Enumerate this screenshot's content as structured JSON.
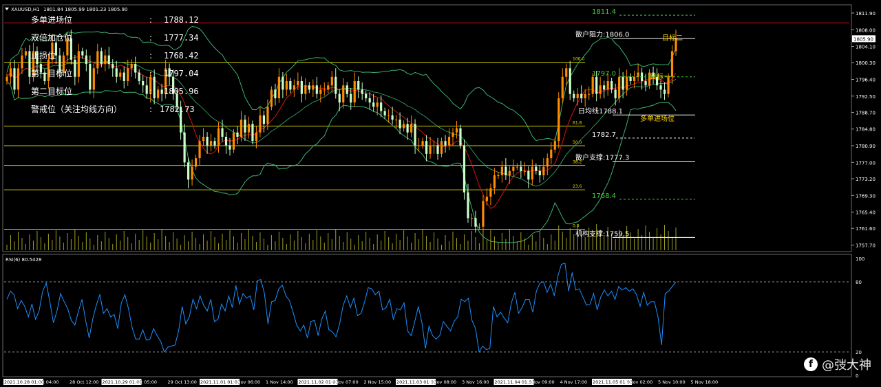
{
  "header": {
    "symbol": "XAUUSD,H1",
    "ohlc": "1801.84 1805.99 1801.23 1805.90"
  },
  "info_panel": [
    {
      "label": "多单进场位",
      "sep": ":",
      "value": "1788.12"
    },
    {
      "label": "双倍加仓位",
      "sep": ":",
      "value": "1777.34"
    },
    {
      "label": "止损位",
      "sep": ":",
      "value": "1768.42"
    },
    {
      "label": "第一目标位",
      "sep": ":",
      "value": "1797.04"
    },
    {
      "label": "第二目标位",
      "sep": ":",
      "value": "1805.96"
    },
    {
      "label": "警戒位（关注均线方向）",
      "sep": ":",
      "value": "1782.73"
    }
  ],
  "price_axis": {
    "ticks": [
      "1811.90",
      "1808.00",
      "1804.10",
      "1800.30",
      "1796.40",
      "1792.50",
      "1788.70",
      "1784.80",
      "1780.90",
      "1777.00",
      "1773.20",
      "1769.30",
      "1765.40",
      "1761.60",
      "1757.70"
    ],
    "current_price": "1805.90",
    "range": [
      1756.5,
      1813.5
    ]
  },
  "rsi": {
    "label": "RSI(6) 80.5428",
    "ticks": [
      "100",
      "80",
      "20",
      "0"
    ],
    "levels": [
      80,
      20
    ],
    "values": [
      65,
      72,
      69,
      57,
      64,
      59,
      50,
      61,
      48,
      55,
      72,
      79,
      63,
      45,
      55,
      70,
      63,
      57,
      47,
      43,
      55,
      65,
      47,
      32,
      48,
      60,
      69,
      53,
      57,
      50,
      52,
      40,
      62,
      69,
      57,
      41,
      31,
      31,
      39,
      30,
      31,
      40,
      34,
      29,
      20,
      24,
      25,
      26,
      38,
      59,
      44,
      50,
      65,
      57,
      68,
      60,
      55,
      65,
      46,
      48,
      61,
      55,
      68,
      58,
      77,
      61,
      70,
      66,
      68,
      56,
      81,
      82,
      70,
      44,
      63,
      64,
      74,
      77,
      68,
      64,
      54,
      43,
      38,
      43,
      32,
      46,
      47,
      34,
      48,
      55,
      39,
      37,
      33,
      44,
      60,
      68,
      58,
      66,
      51,
      53,
      63,
      75,
      74,
      69,
      72,
      56,
      58,
      65,
      48,
      57,
      56,
      62,
      38,
      34,
      46,
      59,
      45,
      23,
      42,
      34,
      31,
      34,
      46,
      42,
      38,
      46,
      50,
      65,
      63,
      66,
      47,
      40,
      20,
      25,
      22,
      23,
      59,
      50,
      54,
      49,
      45,
      62,
      71,
      53,
      58,
      65,
      65,
      54,
      72,
      79,
      80,
      71,
      78,
      68,
      85,
      95,
      96,
      72,
      88,
      73,
      74,
      67,
      60,
      61,
      70,
      56,
      67,
      73,
      68,
      72,
      65,
      76,
      73,
      75,
      72,
      74,
      69,
      59,
      71,
      60,
      63,
      63,
      50,
      26,
      70,
      72,
      76,
      80
    ]
  },
  "time_axis": [
    "2021.10.28 01:00",
    "Oct 04:00",
    "28 Oct 12:00",
    "2021.10.29 01:00",
    "Oct 05:00",
    "29 Oct 13:00",
    "2021.11.01 01:00",
    "1 Nov 06:00",
    "1 Nov 14:00",
    "2021.11.02 01:00",
    "2 Nov 07:00",
    "2 Nov 15:00",
    "2021.11.03 01:00",
    "3 Nov 08:00",
    "3 Nov 16:00",
    "2021.11.04 01:00",
    "4 Nov 09:00",
    "4 Nov 17:00",
    "2021.11.05 01:00",
    "5 Nov 02:00",
    "5 Nov 10:00",
    "5 Nov 18:00"
  ],
  "annotations": [
    {
      "text": "散户阻力:1806.0",
      "price": 1806.0,
      "color": "#ffffff",
      "style": "solid"
    },
    {
      "text": "日均线1788.1",
      "price": 1788.1,
      "color": "#ffffff",
      "style": "solid"
    },
    {
      "text": "1782.7",
      "price": 1782.7,
      "color": "#ffffff",
      "style": "dashed"
    },
    {
      "text": "散户支撑:1777.3",
      "price": 1777.3,
      "color": "#ffffff",
      "style": "solid"
    },
    {
      "text": "机构支撑:1759.5",
      "price": 1759.5,
      "color": "#ffffff",
      "style": "solid"
    },
    {
      "text": "1811.4",
      "price": 1811.4,
      "color": "#39d62a",
      "style": "dashed"
    },
    {
      "text": "1797.0",
      "price": 1797.0,
      "color": "#39d62a",
      "style": "dashed"
    },
    {
      "text": "1768.4",
      "price": 1768.4,
      "color": "#39d62a",
      "style": "dashed"
    },
    {
      "text": "目标二",
      "price": 1806.0,
      "color": "#ffd700",
      "style": "none"
    },
    {
      "text": "目标一",
      "price": 1797.0,
      "color": "#ffd700",
      "style": "none"
    },
    {
      "text": "多单进场位",
      "price": 1788.1,
      "color": "#ffd700",
      "style": "none"
    }
  ],
  "fib_levels": [
    {
      "label": "100.0",
      "price": 1800.4
    },
    {
      "label": "61.8",
      "price": 1785.5
    },
    {
      "label": "50.0",
      "price": 1780.9
    },
    {
      "label": "38.2",
      "price": 1776.3
    },
    {
      "label": "23.6",
      "price": 1770.6
    },
    {
      "label": "0.0",
      "price": 1761.4
    }
  ],
  "resistance_line": {
    "price": 1809.6,
    "color": "#d01010"
  },
  "chart_data": {
    "type": "candlestick",
    "title": "",
    "timeframe": "H1",
    "close": [
      1797,
      1799,
      1794,
      1799,
      1802,
      1803,
      1797,
      1803,
      1800,
      1798,
      1796,
      1801,
      1805,
      1802,
      1798,
      1802,
      1806,
      1801,
      1797,
      1803,
      1802,
      1800,
      1794,
      1799,
      1803,
      1800,
      1802,
      1800,
      1799,
      1797,
      1798,
      1796,
      1799,
      1800,
      1798,
      1796,
      1795,
      1793,
      1797,
      1792,
      1794,
      1793,
      1799,
      1797,
      1793,
      1790,
      1784,
      1777,
      1773,
      1776,
      1778,
      1782,
      1783,
      1781,
      1782,
      1781,
      1785,
      1783,
      1781,
      1780,
      1784,
      1783,
      1787,
      1784,
      1786,
      1782,
      1784,
      1788,
      1786,
      1790,
      1794,
      1792,
      1797,
      1794,
      1796,
      1794,
      1795,
      1796,
      1793,
      1795,
      1794,
      1795,
      1793,
      1794,
      1794,
      1795,
      1797,
      1793,
      1791,
      1795,
      1793,
      1791,
      1796,
      1794,
      1793,
      1792,
      1791,
      1790,
      1791,
      1789,
      1788,
      1788,
      1787,
      1787,
      1785,
      1786,
      1784,
      1786,
      1781,
      1781,
      1782,
      1779,
      1781,
      1781,
      1779,
      1782,
      1781,
      1783,
      1784,
      1785,
      1781,
      1770,
      1764,
      1764,
      1762,
      1762,
      1768,
      1769,
      1771,
      1774,
      1774,
      1776,
      1774,
      1775,
      1776,
      1776,
      1775,
      1775,
      1773,
      1776,
      1775,
      1774,
      1776,
      1778,
      1780,
      1782,
      1792,
      1797,
      1799,
      1793,
      1792,
      1793,
      1792,
      1793,
      1793,
      1797,
      1793,
      1795,
      1794,
      1796,
      1794,
      1792,
      1797,
      1794,
      1797,
      1796,
      1797,
      1798,
      1796,
      1795,
      1798,
      1797,
      1795,
      1794,
      1793,
      1797,
      1803,
      1806
    ]
  },
  "watermark": {
    "logo_text": "f",
    "text": "@弢大神"
  }
}
